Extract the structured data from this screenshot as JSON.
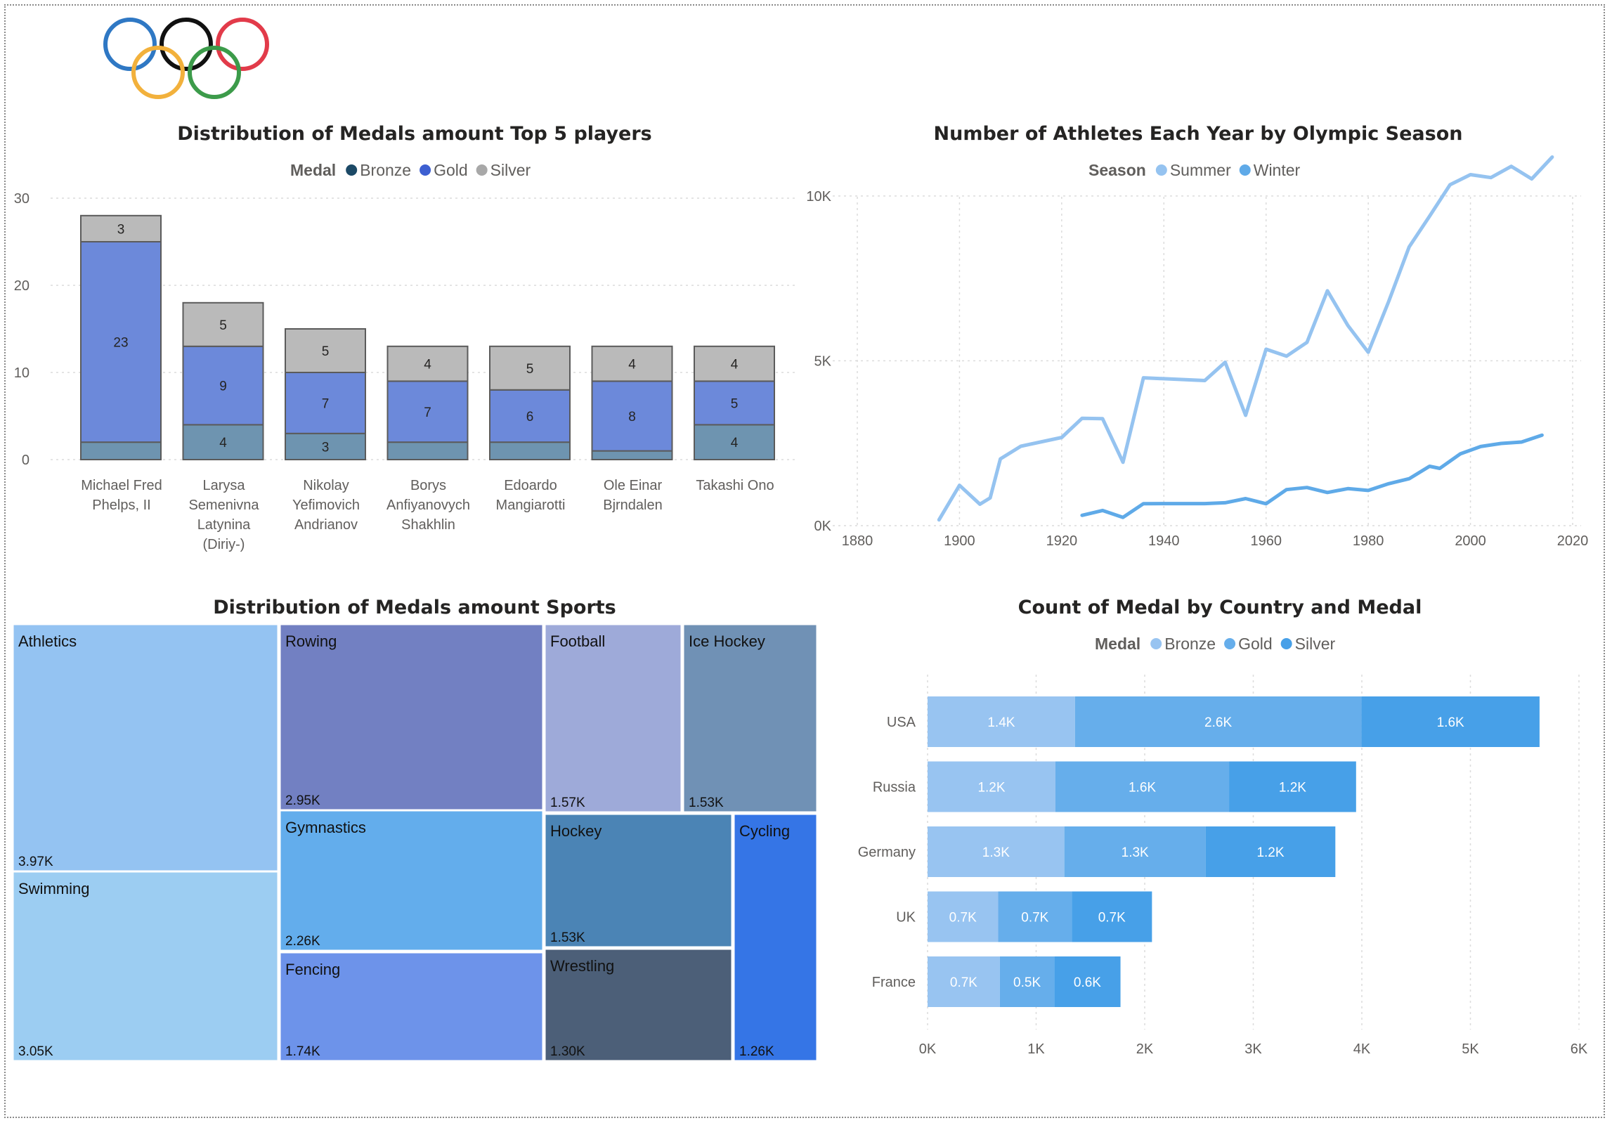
{
  "logo": {
    "name": "olympic-rings",
    "colors": [
      "#2f78c4",
      "#111111",
      "#e23b4a",
      "#f2b13c",
      "#3c9b4a"
    ]
  },
  "chart_data": [
    {
      "id": "players",
      "type": "bar",
      "stacked": true,
      "title": "Distribution of Medals amount Top 5 players",
      "legend_title": "Medal",
      "legend_position": "top-center",
      "categories": [
        [
          "Michael Fred",
          "Phelps, II"
        ],
        [
          "Larysa",
          "Semenivna",
          "Latynina",
          "(Diriy-)"
        ],
        [
          "Nikolay",
          "Yefimovich",
          "Andrianov"
        ],
        [
          "Borys",
          "Anfiyanovych",
          "Shakhlin"
        ],
        [
          "Edoardo",
          "Mangiarotti"
        ],
        [
          "Ole Einar",
          "Bjrndalen"
        ],
        [
          "Takashi Ono"
        ]
      ],
      "series": [
        {
          "name": "Bronze",
          "color": "#6e94b0",
          "legend_color": "#1c4966",
          "values": [
            2,
            4,
            3,
            2,
            2,
            1,
            4
          ],
          "labels": [
            "",
            "4",
            "3",
            "",
            "",
            "",
            "4"
          ]
        },
        {
          "name": "Gold",
          "color": "#6c89da",
          "legend_color": "#3d5fd1",
          "values": [
            23,
            9,
            7,
            7,
            6,
            8,
            5
          ],
          "labels": [
            "23",
            "9",
            "7",
            "7",
            "6",
            "8",
            "5"
          ]
        },
        {
          "name": "Silver",
          "color": "#bababa",
          "legend_color": "#a8a8a8",
          "values": [
            3,
            5,
            5,
            4,
            5,
            4,
            4
          ],
          "labels": [
            "3",
            "5",
            "5",
            "4",
            "5",
            "4",
            "4"
          ]
        }
      ],
      "ylim": [
        0,
        30
      ],
      "yticks": [
        0,
        10,
        20,
        30
      ],
      "grid": true
    },
    {
      "id": "athletes",
      "type": "line",
      "title": "Number of Athletes Each Year by Olympic Season",
      "legend_title": "Season",
      "legend_position": "top-center",
      "xlim": [
        1880,
        2020
      ],
      "xticks": [
        1880,
        1900,
        1920,
        1940,
        1960,
        1980,
        2000,
        2020
      ],
      "ylim": [
        0,
        12000
      ],
      "yticks": [
        0,
        5000,
        10000
      ],
      "ytick_labels": [
        "0K",
        "5K",
        "10K"
      ],
      "grid": true,
      "series": [
        {
          "name": "Summer",
          "color": "#95c3f0",
          "x": [
            1896,
            1900,
            1904,
            1906,
            1908,
            1912,
            1920,
            1924,
            1928,
            1932,
            1936,
            1948,
            1952,
            1956,
            1960,
            1964,
            1968,
            1972,
            1976,
            1980,
            1984,
            1988,
            1992,
            1996,
            2000,
            2004,
            2008,
            2012,
            2016
          ],
          "y": [
            176,
            1224,
            650,
            841,
            2024,
            2409,
            2676,
            3256,
            3247,
            1922,
            4484,
            4402,
            4955,
            3347,
            5352,
            5140,
            5558,
            7123,
            6073,
            5259,
            6799,
            8454,
            9386,
            10339,
            10646,
            10557,
            10899,
            10517,
            11179
          ]
        },
        {
          "name": "Winter",
          "color": "#5faae8",
          "x": [
            1924,
            1928,
            1932,
            1936,
            1948,
            1952,
            1956,
            1960,
            1964,
            1968,
            1972,
            1976,
            1980,
            1984,
            1988,
            1992,
            1994,
            1998,
            2002,
            2006,
            2010,
            2014
          ],
          "y": [
            313,
            460,
            252,
            668,
            669,
            694,
            821,
            665,
            1094,
            1158,
            1006,
            1123,
            1067,
            1272,
            1423,
            1801,
            1738,
            2176,
            2399,
            2494,
            2536,
            2745
          ]
        }
      ]
    },
    {
      "id": "sports",
      "type": "treemap",
      "title": "Distribution of Medals amount Sports",
      "items": [
        {
          "name": "Athletics",
          "value": "3.97K",
          "color": "#94c3f2"
        },
        {
          "name": "Swimming",
          "value": "3.05K",
          "color": "#9ccdf2"
        },
        {
          "name": "Rowing",
          "value": "2.95K",
          "color": "#7280c2"
        },
        {
          "name": "Gymnastics",
          "value": "2.26K",
          "color": "#63adec"
        },
        {
          "name": "Fencing",
          "value": "1.74K",
          "color": "#6d93ea"
        },
        {
          "name": "Football",
          "value": "1.57K",
          "color": "#9eaad9"
        },
        {
          "name": "Ice Hockey",
          "value": "1.53K",
          "color": "#7091b5"
        },
        {
          "name": "Hockey",
          "value": "1.53K",
          "color": "#4b84b5"
        },
        {
          "name": "Wrestling",
          "value": "1.30K",
          "color": "#4c5f78"
        },
        {
          "name": "Cycling",
          "value": "1.26K",
          "color": "#3575e6"
        }
      ]
    },
    {
      "id": "countries",
      "type": "bar",
      "orientation": "horizontal",
      "stacked": true,
      "title": "Count of Medal by Country and Medal",
      "legend_title": "Medal",
      "legend_position": "top-center",
      "categories": [
        "USA",
        "Russia",
        "Germany",
        "UK",
        "France"
      ],
      "xlim": [
        0,
        6000
      ],
      "xticks": [
        0,
        1000,
        2000,
        3000,
        4000,
        5000,
        6000
      ],
      "xtick_labels": [
        "0K",
        "1K",
        "2K",
        "3K",
        "4K",
        "5K",
        "6K"
      ],
      "grid": true,
      "series": [
        {
          "name": "Bronze",
          "color": "#98c4f1",
          "values": [
            1358,
            1178,
            1260,
            650,
            666
          ],
          "labels": [
            "1.4K",
            "1.2K",
            "1.3K",
            "0.7K",
            "0.7K"
          ]
        },
        {
          "name": "Gold",
          "color": "#66aeeb",
          "values": [
            2638,
            1599,
            1301,
            678,
            501
          ],
          "labels": [
            "2.6K",
            "1.6K",
            "1.3K",
            "0.7K",
            "0.5K"
          ]
        },
        {
          "name": "Silver",
          "color": "#47a0e8",
          "values": [
            1641,
            1170,
            1195,
            739,
            610
          ],
          "labels": [
            "1.6K",
            "1.2K",
            "1.2K",
            "0.7K",
            "0.6K"
          ]
        }
      ]
    }
  ]
}
